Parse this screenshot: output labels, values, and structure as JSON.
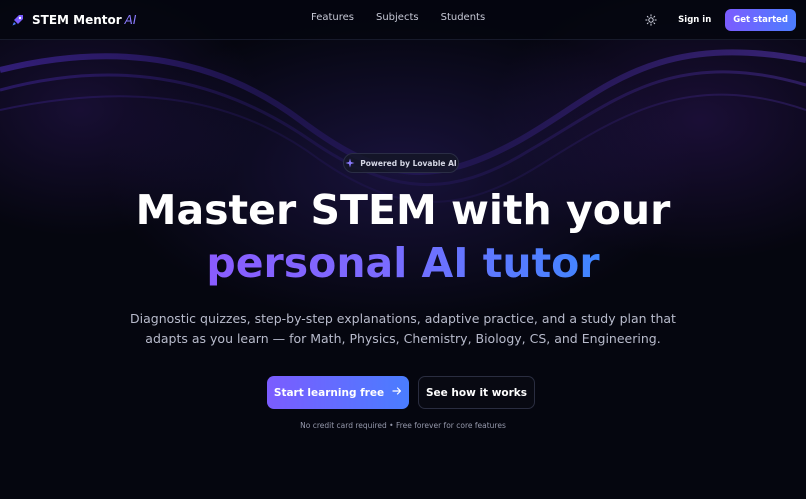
{
  "brand": {
    "name": "STEM Mentor",
    "ai_suffix": "AI",
    "logo_icon": "rocket-icon"
  },
  "nav": {
    "links": [
      {
        "label": "Features"
      },
      {
        "label": "Subjects"
      },
      {
        "label": "Students"
      }
    ],
    "theme_icon": "sun-icon",
    "signin_label": "Sign in",
    "get_started_label": "Get started"
  },
  "hero": {
    "badge": "Powered by Lovable AI",
    "badge_icon": "sparkles-icon",
    "headline_line1": "Master STEM with your",
    "headline_line2": "personal AI tutor",
    "subtitle": "Diagnostic quizzes, step-by-step explanations, adaptive practice, and a study plan that adapts as you learn — for Math, Physics, Chemistry, Biology, CS, and Engineering.",
    "primary_cta": "Start learning free",
    "primary_cta_icon": "arrow-right-icon",
    "secondary_cta": "See how it works",
    "fineprint": "No credit card required • Free forever for core features"
  },
  "colors": {
    "background": "#05060f",
    "accent_start": "#7b5cff",
    "accent_end": "#4a7dff"
  }
}
